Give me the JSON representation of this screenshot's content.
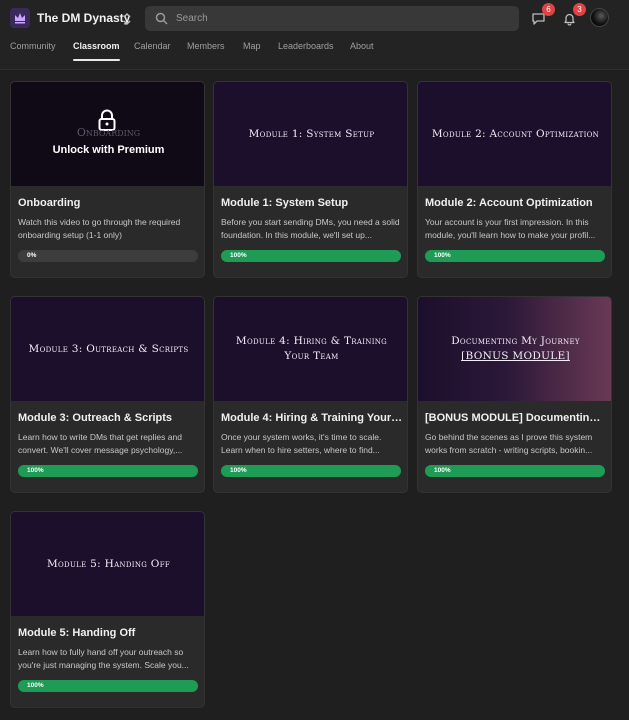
{
  "header": {
    "group_name": "The DM Dynasty",
    "search_placeholder": "Search",
    "chat_badge": "6",
    "notifications_badge": "3"
  },
  "tabs": [
    {
      "label": "Community"
    },
    {
      "label": "Classroom",
      "active": true
    },
    {
      "label": "Calendar"
    },
    {
      "label": "Members"
    },
    {
      "label": "Map"
    },
    {
      "label": "Leaderboards"
    },
    {
      "label": "About"
    }
  ],
  "colors": {
    "progress": "#1e9b55",
    "badge": "#e04343",
    "cover": "#1c0f2c"
  },
  "courses": [
    {
      "locked": true,
      "cover_title": "Onboarding",
      "lock_text": "Unlock with Premium",
      "title": "Onboarding",
      "description": "Watch this video to go through the required onboarding setup (1-1 only)",
      "progress": 0,
      "progress_label": "0%"
    },
    {
      "cover_title": "Module 1: System Setup",
      "title": "Module 1: System Setup",
      "description": "Before you start sending DMs, you need a solid foundation. In this module, we'll set up...",
      "progress": 100,
      "progress_label": "100%"
    },
    {
      "cover_title": "Module 2: Account Optimization",
      "title": "Module 2: Account Optimization",
      "description": "Your account is your first impression. In this module, you'll learn how to make your profil...",
      "progress": 100,
      "progress_label": "100%"
    },
    {
      "cover_title": "Module 3: Outreach & Scripts",
      "title": "Module 3: Outreach & Scripts",
      "description": "Learn how to write DMs that get replies and convert. We'll cover message psychology,...",
      "progress": 100,
      "progress_label": "100%"
    },
    {
      "cover_title": "Module 4: Hiring & Training Your Team",
      "title": "Module 4: Hiring & Training Your ...",
      "description": "Once your system works, it's time to scale. Learn when to hire setters, where to find...",
      "progress": 100,
      "progress_label": "100%"
    },
    {
      "cover_title": "Documenting My Journey",
      "cover_subtitle": "[BONUS MODULE]",
      "bonus": true,
      "title": "[BONUS MODULE] Documenting ...",
      "description": "Go behind the scenes as I prove this system works from scratch - writing scripts, bookin...",
      "progress": 100,
      "progress_label": "100%"
    },
    {
      "cover_title": "Module 5: Handing Off",
      "title": "Module 5: Handing Off",
      "description": "Learn how to fully hand off your outreach so you're just managing the system. Scale you...",
      "progress": 100,
      "progress_label": "100%"
    }
  ]
}
